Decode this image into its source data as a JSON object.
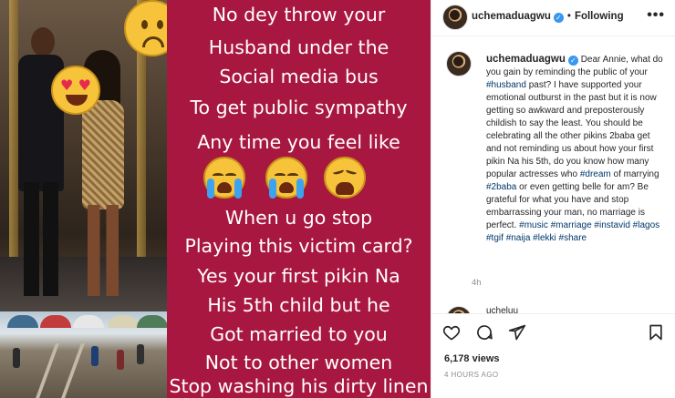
{
  "post": {
    "card_lines": [
      "No dey throw your",
      "Husband under the",
      "Social media bus",
      "To get public sympathy",
      "Any time you feel like",
      "When u go stop",
      "Playing this victim card?",
      "Yes your first pikin Na",
      "His 5th child but he",
      "Got married to you",
      "Not to other women",
      "Stop washing his dirty linen"
    ],
    "card_emojis": [
      "loudly-crying-face",
      "loudly-crying-face",
      "weary-face"
    ],
    "photo_emojis": [
      "frowning-face",
      "heart-eyes-face"
    ],
    "card_color": "#a8173f"
  },
  "header": {
    "username": "uchemaduagwu",
    "separator": "•",
    "follow_label": "Following",
    "more_label": "•••"
  },
  "caption": {
    "username": "uchemaduagwu",
    "segments": [
      {
        "t": "Dear Annie, what do you gain by reminding the public of your "
      },
      {
        "t": "#husband",
        "tag": true
      },
      {
        "t": " past? I have supported your emotional outburst in the past but it is now getting so awkward and preposterously childish to say the least. You should be celebrating all the other pikins 2baba get and not reminding us about how your first pikin Na his 5th, do you know how many popular actresses who "
      },
      {
        "t": "#dream",
        "tag": true
      },
      {
        "t": " of marrying "
      },
      {
        "t": "#2baba",
        "tag": true
      },
      {
        "t": " or even getting belle for am? Be grateful for what you have and stop embarrassing your man, no marriage is perfect. "
      },
      {
        "t": "#music",
        "tag": true
      },
      {
        "t": " "
      },
      {
        "t": "#marriage",
        "tag": true
      },
      {
        "t": " "
      },
      {
        "t": "#instavid",
        "tag": true
      },
      {
        "t": " "
      },
      {
        "t": "#lagos",
        "tag": true
      },
      {
        "t": " "
      },
      {
        "t": "#tgif",
        "tag": true
      },
      {
        "t": " "
      },
      {
        "t": "#naija",
        "tag": true
      },
      {
        "t": " "
      },
      {
        "t": "#lekki",
        "tag": true
      },
      {
        "t": " "
      },
      {
        "t": "#share",
        "tag": true
      }
    ],
    "age": "4h"
  },
  "comment_peek": {
    "text": "ucheluu"
  },
  "actions": {
    "icons": [
      "heart-icon",
      "comment-icon",
      "share-icon",
      "save-icon"
    ]
  },
  "stats": {
    "views": "6,178 views",
    "posted": "4 HOURS AGO"
  },
  "colors": {
    "link": "#00376b",
    "verified": "#3897f0",
    "muted": "#8e8e8e"
  }
}
